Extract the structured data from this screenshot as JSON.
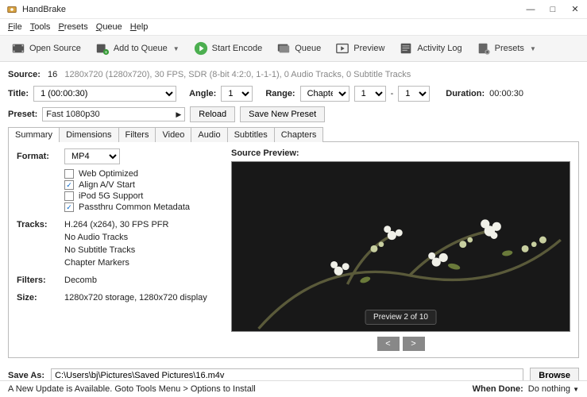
{
  "app": {
    "title": "HandBrake"
  },
  "window": {
    "min": "—",
    "max": "□",
    "close": "✕"
  },
  "menu": {
    "file": "File",
    "tools": "Tools",
    "presets": "Presets",
    "queue": "Queue",
    "help": "Help"
  },
  "toolbar": {
    "open_source": "Open Source",
    "add_to_queue": "Add to Queue",
    "start_encode": "Start Encode",
    "queue": "Queue",
    "preview": "Preview",
    "activity_log": "Activity Log",
    "presets": "Presets"
  },
  "source": {
    "label": "Source:",
    "name": "16",
    "detail": "1280x720 (1280x720), 30 FPS, SDR (8-bit 4:2:0, 1-1-1), 0 Audio Tracks, 0 Subtitle Tracks"
  },
  "title_row": {
    "title_lbl": "Title:",
    "title_val": "1 (00:00:30)",
    "angle_lbl": "Angle:",
    "angle_val": "1",
    "range_lbl": "Range:",
    "range_type": "Chapters",
    "range_from": "1",
    "range_dash": "-",
    "range_to": "1",
    "duration_lbl": "Duration:",
    "duration_val": "00:00:30"
  },
  "preset_row": {
    "preset_lbl": "Preset:",
    "preset_val": "Fast 1080p30",
    "reload": "Reload",
    "save_new": "Save New Preset"
  },
  "tabs": {
    "summary": "Summary",
    "dimensions": "Dimensions",
    "filters": "Filters",
    "video": "Video",
    "audio": "Audio",
    "subtitles": "Subtitles",
    "chapters": "Chapters"
  },
  "summary": {
    "format_lbl": "Format:",
    "format_val": "MP4",
    "opt_web": "Web Optimized",
    "opt_align": "Align A/V Start",
    "opt_ipod": "iPod 5G Support",
    "opt_meta": "Passthru Common Metadata",
    "tracks_lbl": "Tracks:",
    "tracks": {
      "video": "H.264 (x264), 30 FPS PFR",
      "audio": "No Audio Tracks",
      "subs": "No Subtitle Tracks",
      "chapters": "Chapter Markers"
    },
    "filters_lbl": "Filters:",
    "filters_val": "Decomb",
    "size_lbl": "Size:",
    "size_val": "1280x720 storage, 1280x720 display"
  },
  "preview": {
    "label": "Source Preview:",
    "badge": "Preview 2 of 10",
    "prev": "<",
    "next": ">"
  },
  "saveas": {
    "label": "Save As:",
    "path": "C:\\Users\\bj\\Pictures\\Saved Pictures\\16.m4v",
    "browse": "Browse"
  },
  "status": {
    "update": "A New Update is Available. Goto Tools Menu > Options to Install",
    "when_done_lbl": "When Done:",
    "when_done_val": "Do nothing"
  }
}
